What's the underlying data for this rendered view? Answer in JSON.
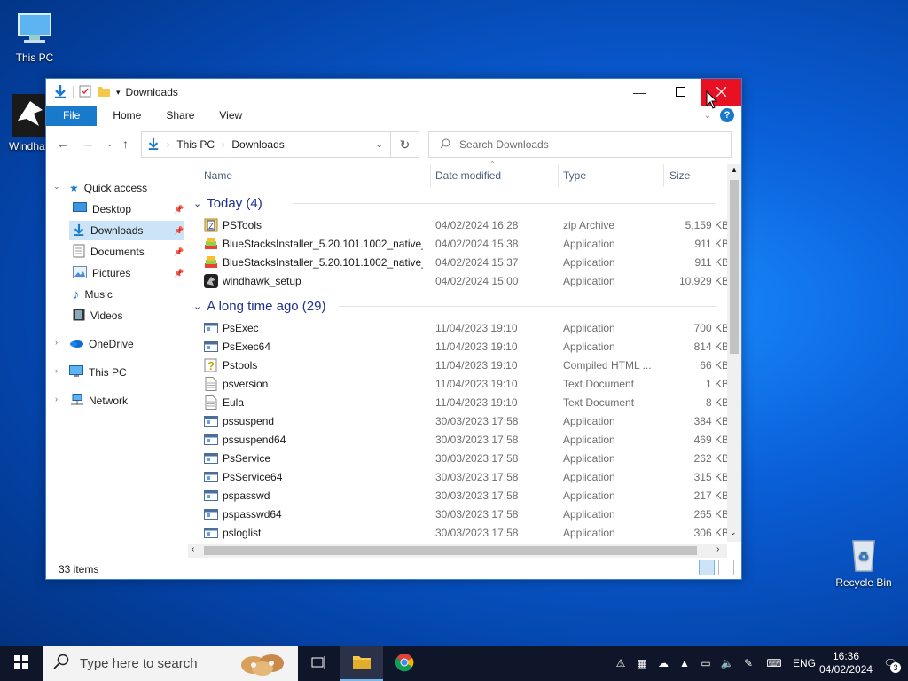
{
  "desktop": {
    "this_pc": "This PC",
    "windhawk": "Windhawk",
    "recycle_bin": "Recycle Bin"
  },
  "window": {
    "title": "Downloads"
  },
  "ribbon": {
    "file": "File",
    "home": "Home",
    "share": "Share",
    "view": "View"
  },
  "address": {
    "root": "This PC",
    "current": "Downloads"
  },
  "search": {
    "placeholder": "Search Downloads"
  },
  "nav": {
    "quick_access": "Quick access",
    "desktop": "Desktop",
    "downloads": "Downloads",
    "documents": "Documents",
    "pictures": "Pictures",
    "music": "Music",
    "videos": "Videos",
    "onedrive": "OneDrive",
    "this_pc": "This PC",
    "network": "Network"
  },
  "columns": {
    "name": "Name",
    "date": "Date modified",
    "type": "Type",
    "size": "Size"
  },
  "groups": {
    "today": "Today (4)",
    "older": "A long time ago (29)"
  },
  "files": [
    {
      "name": "PSTools",
      "date": "04/02/2024 16:28",
      "type": "zip Archive",
      "size": "5,159 KB",
      "icon": "zip-icon"
    },
    {
      "name": "BlueStacksInstaller_5.20.101.1002_native_...",
      "date": "04/02/2024 15:38",
      "type": "Application",
      "size": "911 KB",
      "icon": "bluestacks-icon"
    },
    {
      "name": "BlueStacksInstaller_5.20.101.1002_native_f...",
      "date": "04/02/2024 15:37",
      "type": "Application",
      "size": "911 KB",
      "icon": "bluestacks-icon"
    },
    {
      "name": "windhawk_setup",
      "date": "04/02/2024 15:00",
      "type": "Application",
      "size": "10,929 KB",
      "icon": "windhawk-icon"
    },
    {
      "name": "PsExec",
      "date": "11/04/2023 19:10",
      "type": "Application",
      "size": "700 KB",
      "icon": "app-icon"
    },
    {
      "name": "PsExec64",
      "date": "11/04/2023 19:10",
      "type": "Application",
      "size": "814 KB",
      "icon": "app-icon"
    },
    {
      "name": "Pstools",
      "date": "11/04/2023 19:10",
      "type": "Compiled HTML ...",
      "size": "66 KB",
      "icon": "help-file-icon"
    },
    {
      "name": "psversion",
      "date": "11/04/2023 19:10",
      "type": "Text Document",
      "size": "1 KB",
      "icon": "text-file-icon"
    },
    {
      "name": "Eula",
      "date": "11/04/2023 19:10",
      "type": "Text Document",
      "size": "8 KB",
      "icon": "text-file-icon"
    },
    {
      "name": "pssuspend",
      "date": "30/03/2023 17:58",
      "type": "Application",
      "size": "384 KB",
      "icon": "app-icon"
    },
    {
      "name": "pssuspend64",
      "date": "30/03/2023 17:58",
      "type": "Application",
      "size": "469 KB",
      "icon": "app-icon"
    },
    {
      "name": "PsService",
      "date": "30/03/2023 17:58",
      "type": "Application",
      "size": "262 KB",
      "icon": "app-icon"
    },
    {
      "name": "PsService64",
      "date": "30/03/2023 17:58",
      "type": "Application",
      "size": "315 KB",
      "icon": "app-icon"
    },
    {
      "name": "pspasswd",
      "date": "30/03/2023 17:58",
      "type": "Application",
      "size": "217 KB",
      "icon": "app-icon"
    },
    {
      "name": "pspasswd64",
      "date": "30/03/2023 17:58",
      "type": "Application",
      "size": "265 KB",
      "icon": "app-icon"
    },
    {
      "name": "psloglist",
      "date": "30/03/2023 17:58",
      "type": "Application",
      "size": "306 KB",
      "icon": "app-icon"
    }
  ],
  "status": {
    "items": "33 items"
  },
  "taskbar": {
    "search_placeholder": "Type here to search",
    "lang": "ENG",
    "time": "16:36",
    "date": "04/02/2024",
    "notifications": "3"
  },
  "colors": {
    "accent": "#1979ca",
    "close": "#e81123",
    "selection": "#cce4f7",
    "group": "#1e3287"
  }
}
